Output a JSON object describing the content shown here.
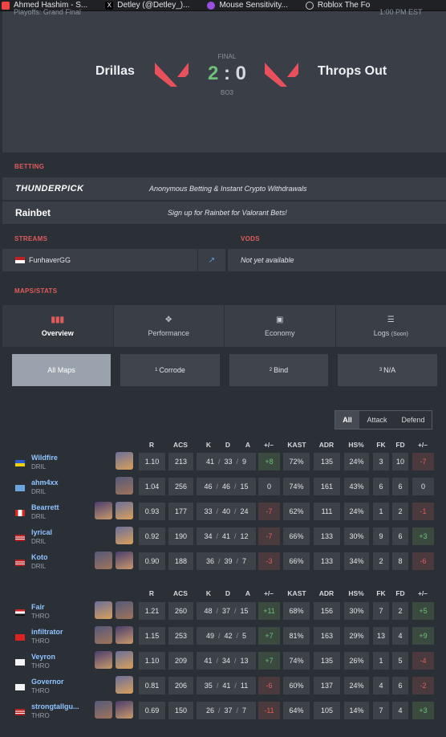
{
  "bookmarks": [
    {
      "label": "Ahmed Hashim - S...",
      "icon": "bookmark-icon",
      "color": "#e44"
    },
    {
      "label": "Detley (@Detley_)...",
      "icon": "x-logo-icon",
      "color": "#fff"
    },
    {
      "label": "Mouse Sensitivity...",
      "icon": "bookmark-icon",
      "color": "#9b4de0"
    },
    {
      "label": "Roblox The Fo",
      "icon": "globe-icon",
      "color": "#ccc"
    }
  ],
  "match": {
    "event": "Playoffs: Grand Final",
    "time": "1:00 PM EST",
    "team1": "Drillas",
    "team2": "Throps Out",
    "status": "FINAL",
    "score1": "2",
    "sep": ":",
    "score2": "0",
    "format": "BO3"
  },
  "betting": {
    "heading": "BETTING",
    "rows": [
      {
        "brand": "THUNDERPICK",
        "text": "Anonymous Betting & Instant Crypto Withdrawals"
      },
      {
        "brand": "Rainbet",
        "text": "Sign up for Rainbet for Valorant Bets!"
      }
    ]
  },
  "streams": {
    "heading": "STREAMS",
    "name": "FunhaverGG"
  },
  "vods": {
    "heading": "VODS",
    "text": "Not yet available"
  },
  "maps_heading": "MAPS/STATS",
  "tabs": [
    {
      "label": "Overview",
      "icon": "bar-chart-icon"
    },
    {
      "label": "Performance",
      "icon": "crosshair-icon"
    },
    {
      "label": "Economy",
      "icon": "money-icon"
    },
    {
      "label": "Logs",
      "soon": "(Soon)",
      "icon": "list-icon"
    }
  ],
  "maps": [
    {
      "num": "",
      "label": "All Maps"
    },
    {
      "num": "1",
      "label": "Corrode"
    },
    {
      "num": "2",
      "label": "Bind"
    },
    {
      "num": "3",
      "label": "N/A"
    }
  ],
  "sides": [
    "All",
    "Attack",
    "Defend"
  ],
  "columns": [
    "R",
    "ACS",
    "K",
    "D",
    "A",
    "+/–",
    "KAST",
    "ADR",
    "HS%",
    "FK",
    "FD",
    "+/–"
  ],
  "team1": [
    {
      "name": "Wildfire",
      "team": "DRIL",
      "flag": "ua",
      "r": "1.10",
      "acs": "213",
      "k": "41",
      "d": "33",
      "a": "9",
      "pm": "+8",
      "kast": "72%",
      "adr": "135",
      "hs": "24%",
      "fk": "3",
      "fd": "10",
      "fpm": "-7",
      "agents": 1
    },
    {
      "name": "ahm4xx",
      "team": "DRIL",
      "flag": "un",
      "r": "1.04",
      "acs": "256",
      "k": "46",
      "d": "46",
      "a": "15",
      "pm": "0",
      "kast": "74%",
      "adr": "161",
      "hs": "43%",
      "fk": "6",
      "fd": "6",
      "fpm": "0",
      "agents": 1
    },
    {
      "name": "Bearrett",
      "team": "DRIL",
      "flag": "ca",
      "r": "0.93",
      "acs": "177",
      "k": "33",
      "d": "40",
      "a": "24",
      "pm": "-7",
      "kast": "62%",
      "adr": "111",
      "hs": "24%",
      "fk": "1",
      "fd": "2",
      "fpm": "-1",
      "agents": 2
    },
    {
      "name": "lyrical",
      "team": "DRIL",
      "flag": "us",
      "r": "0.92",
      "acs": "190",
      "k": "34",
      "d": "41",
      "a": "12",
      "pm": "-7",
      "kast": "66%",
      "adr": "133",
      "hs": "30%",
      "fk": "9",
      "fd": "6",
      "fpm": "+3",
      "agents": 1
    },
    {
      "name": "Koto",
      "team": "DRIL",
      "flag": "us",
      "r": "0.90",
      "acs": "188",
      "k": "36",
      "d": "39",
      "a": "7",
      "pm": "-3",
      "kast": "66%",
      "adr": "133",
      "hs": "34%",
      "fk": "2",
      "fd": "8",
      "fpm": "-6",
      "agents": 2
    }
  ],
  "team2": [
    {
      "name": "Fair",
      "team": "THRO",
      "flag": "eg",
      "r": "1.21",
      "acs": "260",
      "k": "48",
      "d": "37",
      "a": "15",
      "pm": "+11",
      "kast": "68%",
      "adr": "156",
      "hs": "30%",
      "fk": "7",
      "fd": "2",
      "fpm": "+5",
      "agents": 2
    },
    {
      "name": "infiltrator",
      "team": "THRO",
      "flag": "vn",
      "r": "1.15",
      "acs": "253",
      "k": "49",
      "d": "42",
      "a": "5",
      "pm": "+7",
      "kast": "81%",
      "adr": "163",
      "hs": "29%",
      "fk": "13",
      "fd": "4",
      "fpm": "+9",
      "agents": 2
    },
    {
      "name": "Veyron",
      "team": "THRO",
      "flag": "kr",
      "r": "1.10",
      "acs": "209",
      "k": "41",
      "d": "34",
      "a": "13",
      "pm": "+7",
      "kast": "74%",
      "adr": "135",
      "hs": "26%",
      "fk": "1",
      "fd": "5",
      "fpm": "-4",
      "agents": 2
    },
    {
      "name": "Governor",
      "team": "THRO",
      "flag": "kr",
      "r": "0.81",
      "acs": "206",
      "k": "35",
      "d": "41",
      "a": "11",
      "pm": "-6",
      "kast": "60%",
      "adr": "137",
      "hs": "24%",
      "fk": "4",
      "fd": "6",
      "fpm": "-2",
      "agents": 1
    },
    {
      "name": "strongtallgu...",
      "team": "THRO",
      "flag": "us",
      "r": "0.69",
      "acs": "150",
      "k": "26",
      "d": "37",
      "a": "7",
      "pm": "-11",
      "kast": "64%",
      "adr": "105",
      "hs": "14%",
      "fk": "7",
      "fd": "4",
      "fpm": "+3",
      "agents": 2
    }
  ]
}
